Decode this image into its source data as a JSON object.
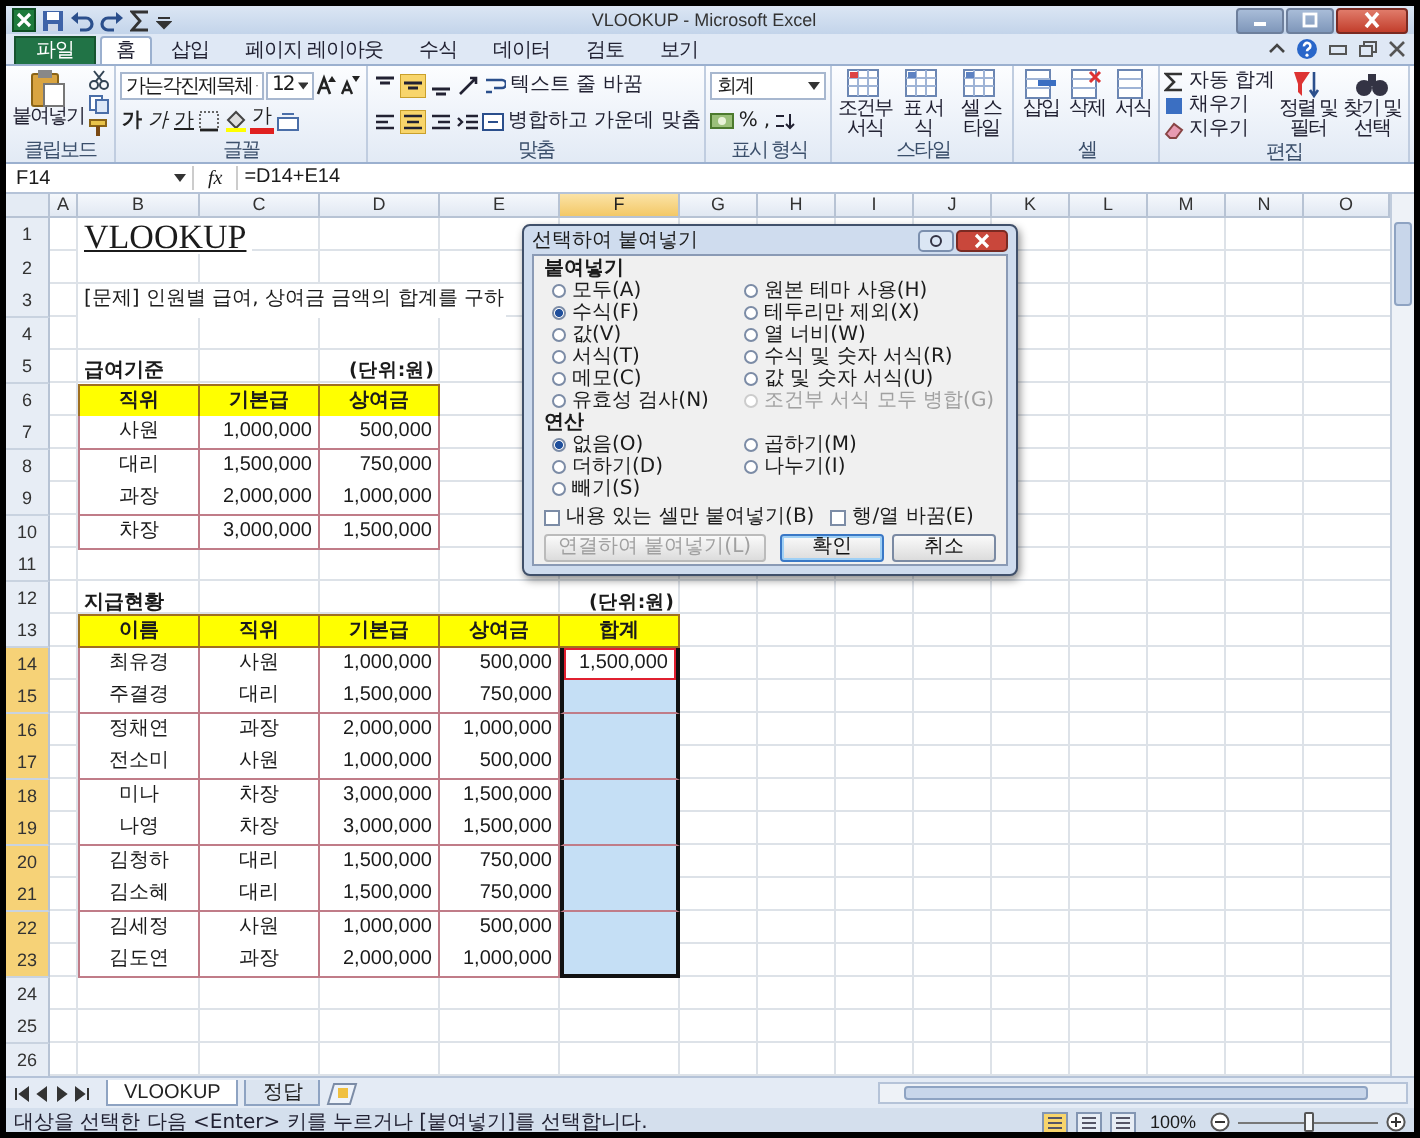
{
  "window": {
    "title": "VLOOKUP - Microsoft Excel"
  },
  "ribbon_tabs": [
    {
      "label": "파일",
      "kind": "file",
      "selected": false
    },
    {
      "label": "홈",
      "kind": "tab",
      "selected": true
    },
    {
      "label": "삽입",
      "kind": "tab",
      "selected": false
    },
    {
      "label": "페이지 레이아웃",
      "kind": "tab",
      "selected": false
    },
    {
      "label": "수식",
      "kind": "tab",
      "selected": false
    },
    {
      "label": "데이터",
      "kind": "tab",
      "selected": false
    },
    {
      "label": "검토",
      "kind": "tab",
      "selected": false
    },
    {
      "label": "보기",
      "kind": "tab",
      "selected": false
    }
  ],
  "ribbon_groups": [
    {
      "label": "클립보드",
      "kind": "clipboard",
      "paste": "붙여넣기"
    },
    {
      "label": "글꼴",
      "kind": "font",
      "font": "가는각진제목체",
      "size": "12",
      "styles": [
        {
          "text": "가",
          "kind": "bold"
        },
        {
          "text": "가",
          "kind": "italic"
        },
        {
          "text": "가",
          "kind": "underline"
        }
      ],
      "font_color": "가"
    },
    {
      "label": "맞춤",
      "kind": "align",
      "wrap": "텍스트 줄 바꿈",
      "merge": "병합하고 가운데 맞춤",
      "vertical_align": [
        {
          "selected": false
        },
        {
          "selected": true
        },
        {
          "selected": false
        }
      ],
      "horizontal_align": [
        {
          "selected": false
        },
        {
          "selected": true
        },
        {
          "selected": false
        }
      ]
    },
    {
      "label": "표시 형식",
      "kind": "number",
      "format": "회계",
      "symbols": [
        "%",
        ","
      ]
    },
    {
      "label": "스타일",
      "kind": "styles",
      "buttons": [
        "조건부 서식",
        "표 서식",
        "셀 스타일"
      ]
    },
    {
      "label": "셀",
      "kind": "cells",
      "buttons": [
        "삽입",
        "삭제",
        "서식"
      ]
    },
    {
      "label": "편집",
      "kind": "editing",
      "small": [
        "자동 합계",
        "채우기",
        "지우기"
      ],
      "big": [
        "정렬 및 필터",
        "찾기 및 선택"
      ]
    }
  ],
  "formula_bar": {
    "name_box": "F14",
    "function_label": "fx",
    "formula": "=D14+E14"
  },
  "sheet": {
    "columns": [
      {
        "label": "A",
        "selected": false
      },
      {
        "label": "B",
        "selected": false
      },
      {
        "label": "C",
        "selected": false
      },
      {
        "label": "D",
        "selected": false
      },
      {
        "label": "E",
        "selected": false
      },
      {
        "label": "F",
        "selected": true
      },
      {
        "label": "G",
        "selected": false
      },
      {
        "label": "H",
        "selected": false
      },
      {
        "label": "I",
        "selected": false
      },
      {
        "label": "J",
        "selected": false
      },
      {
        "label": "K",
        "selected": false
      },
      {
        "label": "L",
        "selected": false
      },
      {
        "label": "M",
        "selected": false
      },
      {
        "label": "N",
        "selected": false
      },
      {
        "label": "O",
        "selected": false
      }
    ],
    "rows": [
      {
        "num": "1",
        "selected": false,
        "cells": [
          {
            "text": "VLOOKUP",
            "kind": "title"
          }
        ]
      },
      {
        "num": "2",
        "selected": false
      },
      {
        "num": "3",
        "selected": false,
        "cells": [
          {
            "text": "[문제] 인원별 급여, 상여금 금액의 합계를 구하",
            "kind": "note"
          }
        ]
      },
      {
        "num": "4",
        "selected": false
      },
      {
        "num": "5",
        "selected": false,
        "cells": [
          {
            "text": "급여기준",
            "kind": "caption"
          },
          null,
          {
            "text": "(단위:원)",
            "kind": "unit"
          }
        ]
      },
      {
        "num": "6",
        "selected": false,
        "cells": [
          {
            "text": "직위",
            "kind": "head"
          },
          {
            "text": "기본급",
            "kind": "head"
          },
          {
            "text": "상여금",
            "kind": "head"
          }
        ]
      },
      {
        "num": "7",
        "selected": false,
        "cells": [
          {
            "text": "사원",
            "kind": "label"
          },
          {
            "text": "1,000,000",
            "kind": "num"
          },
          {
            "text": "500,000",
            "kind": "num"
          }
        ]
      },
      {
        "num": "8",
        "selected": false,
        "cells": [
          {
            "text": "대리",
            "kind": "label"
          },
          {
            "text": "1,500,000",
            "kind": "num"
          },
          {
            "text": "750,000",
            "kind": "num"
          }
        ]
      },
      {
        "num": "9",
        "selected": false,
        "cells": [
          {
            "text": "과장",
            "kind": "label"
          },
          {
            "text": "2,000,000",
            "kind": "num"
          },
          {
            "text": "1,000,000",
            "kind": "num"
          }
        ]
      },
      {
        "num": "10",
        "selected": false,
        "cells": [
          {
            "text": "차장",
            "kind": "label"
          },
          {
            "text": "3,000,000",
            "kind": "num"
          },
          {
            "text": "1,500,000",
            "kind": "num"
          }
        ]
      },
      {
        "num": "11",
        "selected": false
      },
      {
        "num": "12",
        "selected": false,
        "cells": [
          {
            "text": "지급현황",
            "kind": "caption"
          },
          null,
          null,
          null,
          {
            "text": "(단위:원)",
            "kind": "unit"
          }
        ]
      },
      {
        "num": "13",
        "selected": false,
        "cells": [
          {
            "text": "이름",
            "kind": "head"
          },
          {
            "text": "직위",
            "kind": "head"
          },
          {
            "text": "기본급",
            "kind": "head"
          },
          {
            "text": "상여금",
            "kind": "head"
          },
          {
            "text": "합계",
            "kind": "head"
          }
        ]
      },
      {
        "num": "14",
        "selected": true,
        "cells": [
          {
            "text": "최유경",
            "kind": "label"
          },
          {
            "text": "사원",
            "kind": "label"
          },
          {
            "text": "1,000,000",
            "kind": "num"
          },
          {
            "text": "500,000",
            "kind": "num"
          },
          {
            "text": "1,500,000",
            "kind": "active"
          }
        ]
      },
      {
        "num": "15",
        "selected": true,
        "cells": [
          {
            "text": "주결경",
            "kind": "label"
          },
          {
            "text": "대리",
            "kind": "label"
          },
          {
            "text": "1,500,000",
            "kind": "num"
          },
          {
            "text": "750,000",
            "kind": "num"
          },
          {
            "kind": "selected"
          }
        ]
      },
      {
        "num": "16",
        "selected": true,
        "cells": [
          {
            "text": "정채연",
            "kind": "label"
          },
          {
            "text": "과장",
            "kind": "label"
          },
          {
            "text": "2,000,000",
            "kind": "num"
          },
          {
            "text": "1,000,000",
            "kind": "num"
          },
          {
            "kind": "selected"
          }
        ]
      },
      {
        "num": "17",
        "selected": true,
        "cells": [
          {
            "text": "전소미",
            "kind": "label"
          },
          {
            "text": "사원",
            "kind": "label"
          },
          {
            "text": "1,000,000",
            "kind": "num"
          },
          {
            "text": "500,000",
            "kind": "num"
          },
          {
            "kind": "selected"
          }
        ]
      },
      {
        "num": "18",
        "selected": true,
        "cells": [
          {
            "text": "미나",
            "kind": "label"
          },
          {
            "text": "차장",
            "kind": "label"
          },
          {
            "text": "3,000,000",
            "kind": "num"
          },
          {
            "text": "1,500,000",
            "kind": "num"
          },
          {
            "kind": "selected"
          }
        ]
      },
      {
        "num": "19",
        "selected": true,
        "cells": [
          {
            "text": "나영",
            "kind": "label"
          },
          {
            "text": "차장",
            "kind": "label"
          },
          {
            "text": "3,000,000",
            "kind": "num"
          },
          {
            "text": "1,500,000",
            "kind": "num"
          },
          {
            "kind": "selected"
          }
        ]
      },
      {
        "num": "20",
        "selected": true,
        "cells": [
          {
            "text": "김청하",
            "kind": "label"
          },
          {
            "text": "대리",
            "kind": "label"
          },
          {
            "text": "1,500,000",
            "kind": "num"
          },
          {
            "text": "750,000",
            "kind": "num"
          },
          {
            "kind": "selected"
          }
        ]
      },
      {
        "num": "21",
        "selected": true,
        "cells": [
          {
            "text": "김소혜",
            "kind": "label"
          },
          {
            "text": "대리",
            "kind": "label"
          },
          {
            "text": "1,500,000",
            "kind": "num"
          },
          {
            "text": "750,000",
            "kind": "num"
          },
          {
            "kind": "selected"
          }
        ]
      },
      {
        "num": "22",
        "selected": true,
        "cells": [
          {
            "text": "김세정",
            "kind": "label"
          },
          {
            "text": "사원",
            "kind": "label"
          },
          {
            "text": "1,000,000",
            "kind": "num"
          },
          {
            "text": "500,000",
            "kind": "num"
          },
          {
            "kind": "selected"
          }
        ]
      },
      {
        "num": "23",
        "selected": true,
        "cells": [
          {
            "text": "김도연",
            "kind": "label"
          },
          {
            "text": "과장",
            "kind": "label"
          },
          {
            "text": "2,000,000",
            "kind": "num"
          },
          {
            "text": "1,000,000",
            "kind": "num"
          },
          {
            "kind": "selected"
          }
        ]
      },
      {
        "num": "24",
        "selected": false
      },
      {
        "num": "25",
        "selected": false
      },
      {
        "num": "26",
        "selected": false
      }
    ]
  },
  "dialog": {
    "title": "선택하여 붙여넣기",
    "paste_label": "붙여넣기",
    "paste_options": [
      {
        "label": "모두(A)",
        "selected": false,
        "disabled": false
      },
      {
        "label": "원본 테마 사용(H)",
        "selected": false,
        "disabled": false
      },
      {
        "label": "수식(F)",
        "selected": true,
        "disabled": false
      },
      {
        "label": "테두리만 제외(X)",
        "selected": false,
        "disabled": false
      },
      {
        "label": "값(V)",
        "selected": false,
        "disabled": false
      },
      {
        "label": "열 너비(W)",
        "selected": false,
        "disabled": false
      },
      {
        "label": "서식(T)",
        "selected": false,
        "disabled": false
      },
      {
        "label": "수식 및 숫자 서식(R)",
        "selected": false,
        "disabled": false
      },
      {
        "label": "메모(C)",
        "selected": false,
        "disabled": false
      },
      {
        "label": "값 및 숫자 서식(U)",
        "selected": false,
        "disabled": false
      },
      {
        "label": "유효성 검사(N)",
        "selected": false,
        "disabled": false
      },
      {
        "label": "조건부 서식 모두 병합(G)",
        "selected": false,
        "disabled": true
      }
    ],
    "operation_label": "연산",
    "operation_options": [
      {
        "label": "없음(O)",
        "selected": true
      },
      {
        "label": "곱하기(M)",
        "selected": false
      },
      {
        "label": "더하기(D)",
        "selected": false
      },
      {
        "label": "나누기(I)",
        "selected": false
      },
      {
        "label": "빼기(S)",
        "selected": false
      }
    ],
    "checkboxes": [
      {
        "label": "내용 있는 셀만 붙여넣기(B)",
        "checked": false
      },
      {
        "label": "행/열 바꿈(E)",
        "checked": false
      }
    ],
    "buttons": [
      {
        "label": "연결하여 붙여넣기(L)",
        "disabled": true,
        "default": false
      },
      {
        "label": "확인",
        "disabled": false,
        "default": true
      },
      {
        "label": "취소",
        "disabled": false,
        "default": false
      }
    ]
  },
  "sheet_tabs": [
    {
      "label": "VLOOKUP",
      "selected": true
    },
    {
      "label": "정답",
      "selected": false
    }
  ],
  "status_bar": {
    "message": "대상을 선택한 다음 <Enter> 키를 누르거나 [붙여넣기]를 선택합니다.",
    "views": [
      {
        "selected": true
      },
      {
        "selected": false
      },
      {
        "selected": false
      }
    ],
    "zoom": "100%",
    "zoom_slider": {
      "level": 0.5
    }
  }
}
